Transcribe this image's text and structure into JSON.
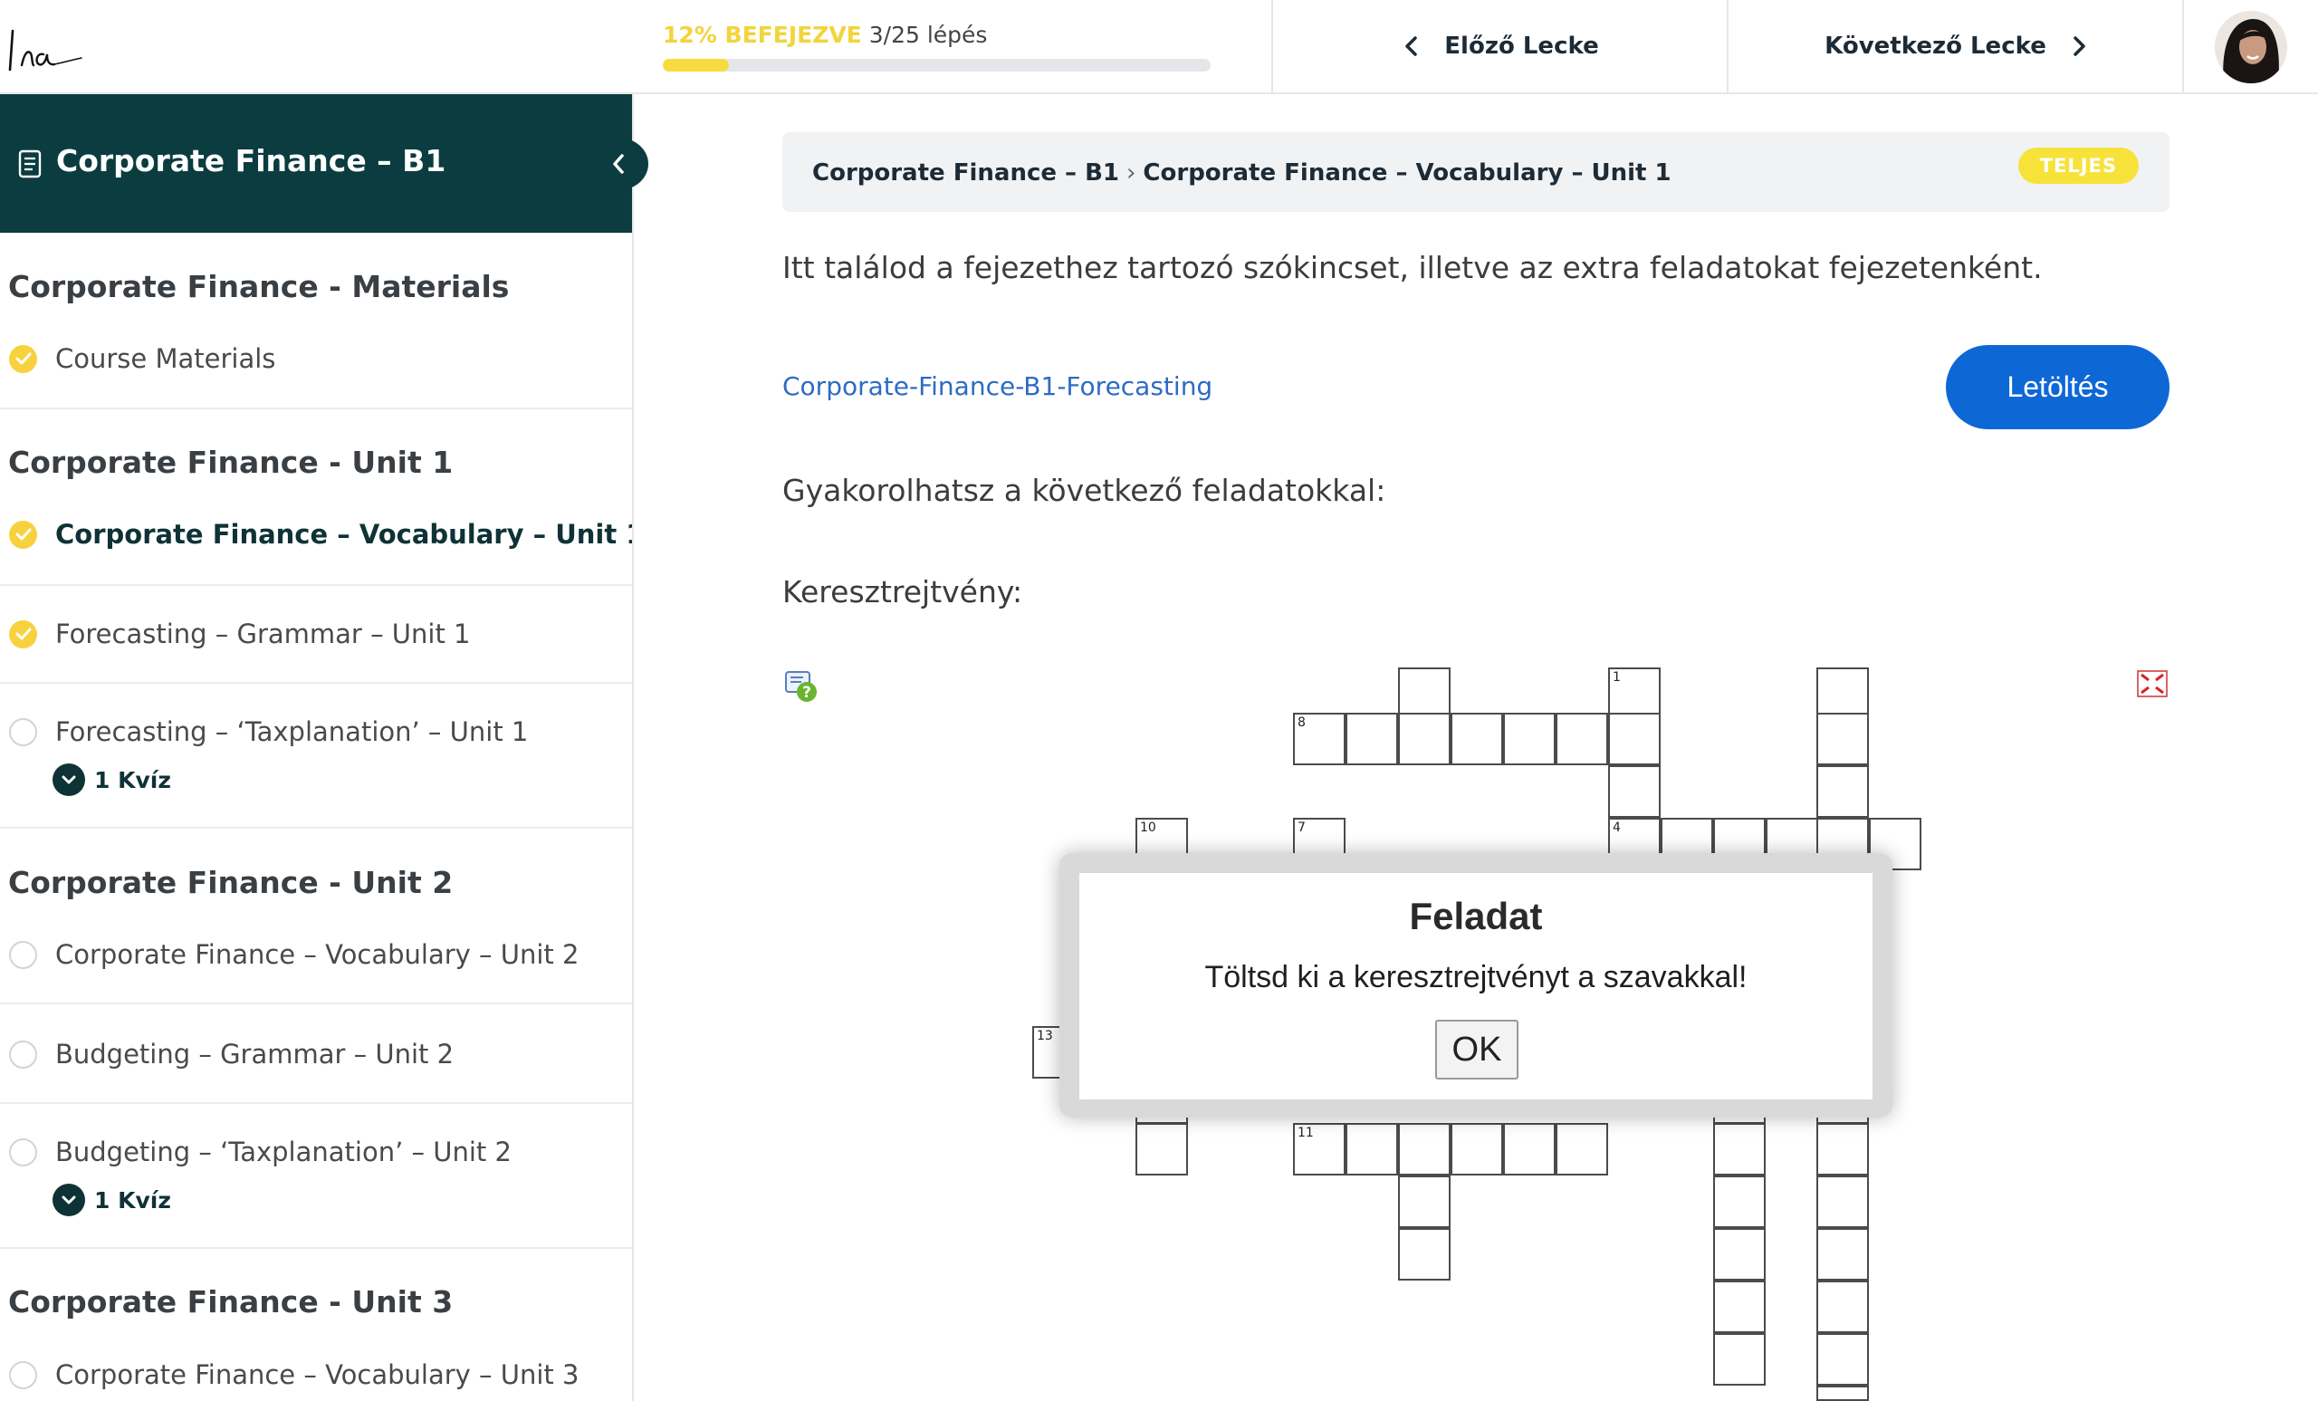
{
  "header": {
    "logo_text": "Ina",
    "progress_percent_label": "12% BEFEJEZVE",
    "progress_steps_label": "3/25 lépés",
    "progress_fraction": 0.12,
    "prev_label": "Előző Lecke",
    "next_label": "Következő Lecke"
  },
  "sidebar": {
    "course_title": "Corporate Finance – B1",
    "sections": [
      {
        "title": "Corporate Finance - Materials"
      },
      {
        "title": "Corporate Finance - Unit 1"
      },
      {
        "title": "Corporate Finance - Unit 2"
      },
      {
        "title": "Corporate Finance - Unit 3"
      }
    ],
    "lessons": [
      {
        "label": "Course Materials",
        "status": "done"
      },
      {
        "label": "Corporate Finance – Vocabulary – Unit 1",
        "status": "done",
        "active": true
      },
      {
        "label": "Forecasting – Grammar – Unit 1",
        "status": "done"
      },
      {
        "label": "Forecasting – ‘Taxplanation’ – Unit 1",
        "status": "open",
        "quiz": "1 Kvíz"
      },
      {
        "label": "Corporate Finance – Vocabulary – Unit 2",
        "status": "open"
      },
      {
        "label": "Budgeting – Grammar – Unit 2",
        "status": "open"
      },
      {
        "label": "Budgeting – ‘Taxplanation’ – Unit 2",
        "status": "open",
        "quiz": "1 Kvíz"
      },
      {
        "label": "Corporate Finance – Vocabulary – Unit 3",
        "status": "open"
      }
    ]
  },
  "main": {
    "breadcrumb": [
      "Corporate Finance – B1",
      "Corporate Finance – Vocabulary – Unit 1"
    ],
    "breadcrumb_separator": "›",
    "status_badge": "TELJES",
    "intro": "Itt találod a fejezethez tartozó szókincset, illetve az extra feladatokat fejezetenként.",
    "file_link": "Corporate-Finance-B1-Forecasting",
    "download_label": "Letöltés",
    "practice_text": "Gyakorolhatsz a következő feladatokkal:",
    "crossword_heading": "Keresztrejtvény:"
  },
  "crossword": {
    "clue_numbers": [
      "1",
      "8",
      "10",
      "7",
      "4",
      "13",
      "11"
    ]
  },
  "modal": {
    "title": "Feladat",
    "text": "Töltsd ki a keresztrejtvényt a szavakkal!",
    "ok_label": "OK"
  },
  "colors": {
    "sidebar_header": "#0b3c3f",
    "accent_yellow": "#f7d23e",
    "primary_blue": "#0d68d6",
    "link_blue": "#2e6bc4"
  }
}
